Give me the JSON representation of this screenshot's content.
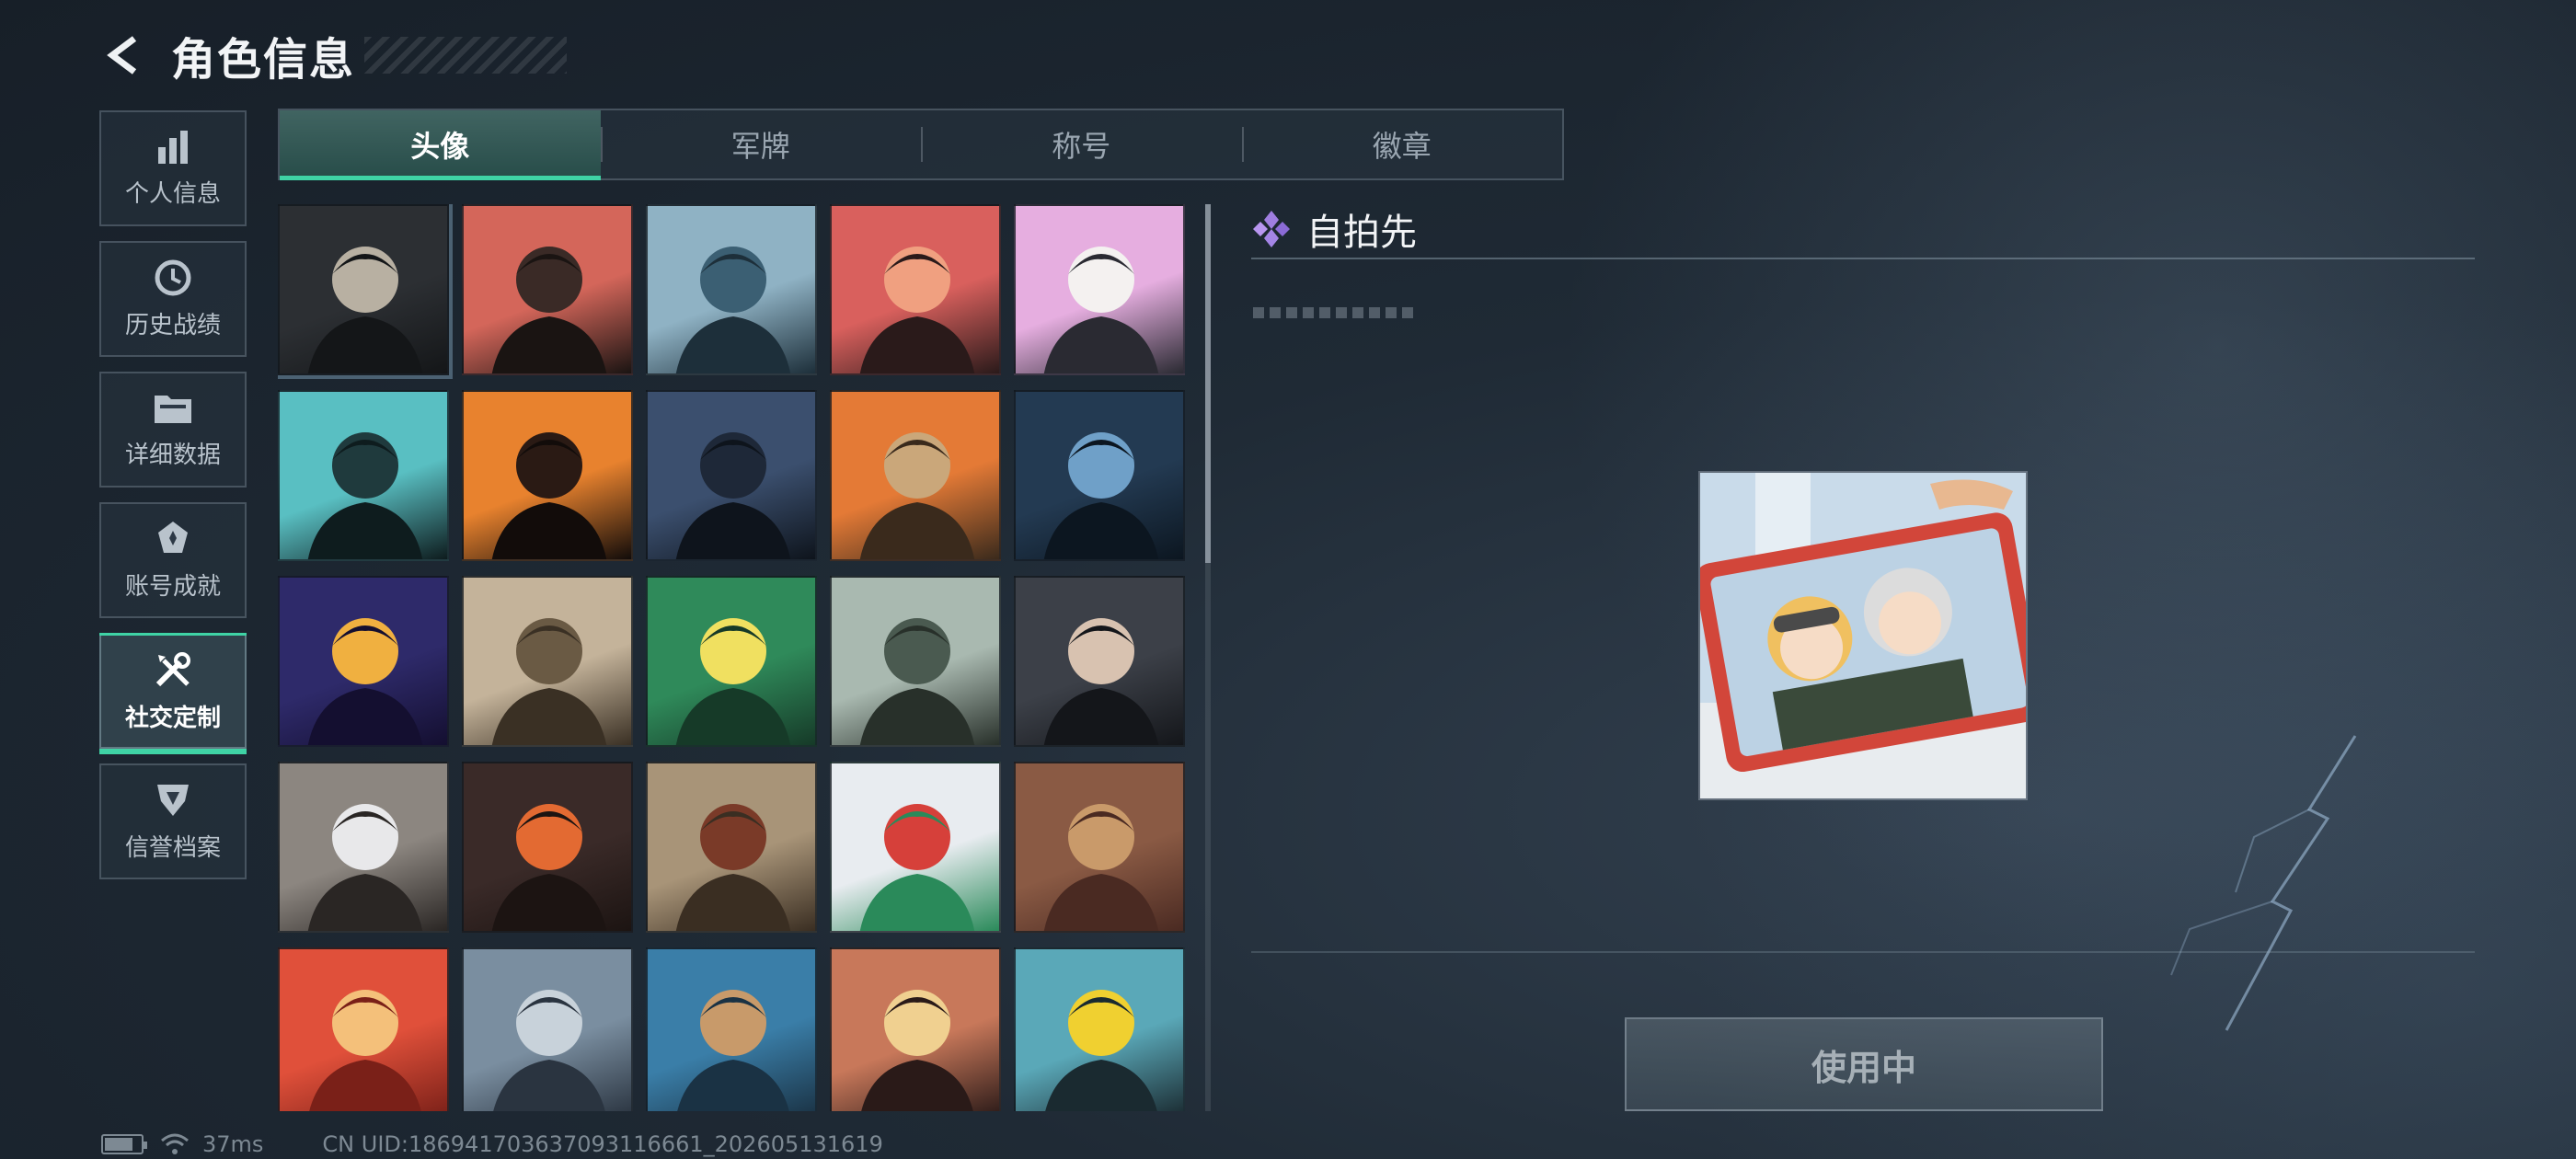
{
  "header": {
    "title": "角色信息"
  },
  "sidebar": {
    "items": [
      {
        "label": "个人信息",
        "icon": "bar-chart-icon"
      },
      {
        "label": "历史战绩",
        "icon": "history-clock-icon"
      },
      {
        "label": "详细数据",
        "icon": "folder-icon"
      },
      {
        "label": "账号成就",
        "icon": "achievement-badge-icon"
      },
      {
        "label": "社交定制",
        "icon": "wrench-screwdriver-icon",
        "active": true
      },
      {
        "label": "信誉档案",
        "icon": "credit-shield-icon"
      }
    ]
  },
  "tabs": [
    {
      "label": "头像",
      "active": true
    },
    {
      "label": "军牌"
    },
    {
      "label": "称号"
    },
    {
      "label": "徽章"
    }
  ],
  "avatars": [
    {
      "name": "avatar-umbrella-figure",
      "bg": "#2c2f33",
      "accent": "#b8b0a2",
      "dark": "#141618"
    },
    {
      "name": "avatar-bearded-cap",
      "bg": "#d4665a",
      "accent": "#3a2a26",
      "dark": "#1a1412"
    },
    {
      "name": "avatar-pilot-woman",
      "bg": "#8fb2c4",
      "accent": "#3b5f73",
      "dark": "#1d2f3a"
    },
    {
      "name": "avatar-helmet-soldier",
      "bg": "#d9605d",
      "accent": "#f0a080",
      "dark": "#2a1a1a"
    },
    {
      "name": "avatar-white-hair-girl",
      "bg": "#e6aee0",
      "accent": "#f4f1f0",
      "dark": "#2a2a32"
    },
    {
      "name": "avatar-goggles-man",
      "bg": "#59bfc2",
      "accent": "#1f3a3d",
      "dark": "#0e1c1e"
    },
    {
      "name": "avatar-masked-orange",
      "bg": "#e8822e",
      "accent": "#2a1a14",
      "dark": "#120c0a"
    },
    {
      "name": "avatar-soldier-night",
      "bg": "#3b4f6e",
      "accent": "#1e2838",
      "dark": "#0e141c"
    },
    {
      "name": "avatar-plane-soldier",
      "bg": "#e47a36",
      "accent": "#caa77a",
      "dark": "#3a2a1c"
    },
    {
      "name": "avatar-sniper-scope",
      "bg": "#233a52",
      "accent": "#6fa0c8",
      "dark": "#0c1620"
    },
    {
      "name": "avatar-book-hand",
      "bg": "#2e2a6a",
      "accent": "#f0b040",
      "dark": "#140f30"
    },
    {
      "name": "avatar-desert-soldiers",
      "bg": "#c4b39a",
      "accent": "#6a5a44",
      "dark": "#3a3024"
    },
    {
      "name": "avatar-exit-door",
      "bg": "#2f8a5a",
      "accent": "#f0e060",
      "dark": "#163a28"
    },
    {
      "name": "avatar-helicopter-field",
      "bg": "#a9b9b0",
      "accent": "#4a5a50",
      "dark": "#28302a"
    },
    {
      "name": "avatar-dark-hair-girl",
      "bg": "#3c4048",
      "accent": "#d8c2b0",
      "dark": "#14161a"
    },
    {
      "name": "avatar-glove-hand",
      "bg": "#8c8680",
      "accent": "#e8e8ea",
      "dark": "#2a2624"
    },
    {
      "name": "avatar-feather",
      "bg": "#3a2a28",
      "accent": "#e36a32",
      "dark": "#1c1412"
    },
    {
      "name": "avatar-old-truck",
      "bg": "#a89478",
      "accent": "#7a3a28",
      "dark": "#3a2e22"
    },
    {
      "name": "avatar-snowman-2025",
      "bg": "#e8ecf0",
      "accent": "#d6403a",
      "dark": "#2a8a5a"
    },
    {
      "name": "avatar-scales-emblem",
      "bg": "#8a5a44",
      "accent": "#c99a6a",
      "dark": "#4a2a22"
    },
    {
      "name": "avatar-heart-bowl",
      "bg": "#e0503a",
      "accent": "#f4c07a",
      "dark": "#7a2018"
    },
    {
      "name": "avatar-mountain-soldier",
      "bg": "#7a8ea0",
      "accent": "#c8d2da",
      "dark": "#2a3440"
    },
    {
      "name": "avatar-thumbs-up",
      "bg": "#3a7ea8",
      "accent": "#c89a6a",
      "dark": "#1a3244"
    },
    {
      "name": "avatar-blonde-girl",
      "bg": "#c8785a",
      "accent": "#f0d090",
      "dark": "#2a1a18"
    },
    {
      "name": "avatar-alligator-sign",
      "bg": "#5aa8b8",
      "accent": "#f0d030",
      "dark": "#1a2a30"
    }
  ],
  "detail": {
    "title": "自拍先",
    "title_icon": "diamond-cluster-icon",
    "preview_name": "selfie-avatar-preview",
    "button_label": "使用中"
  },
  "status": {
    "battery_level": 0.8,
    "ping": "37ms",
    "uid": "CN UID:1869417036370931166​61_202605131619"
  }
}
